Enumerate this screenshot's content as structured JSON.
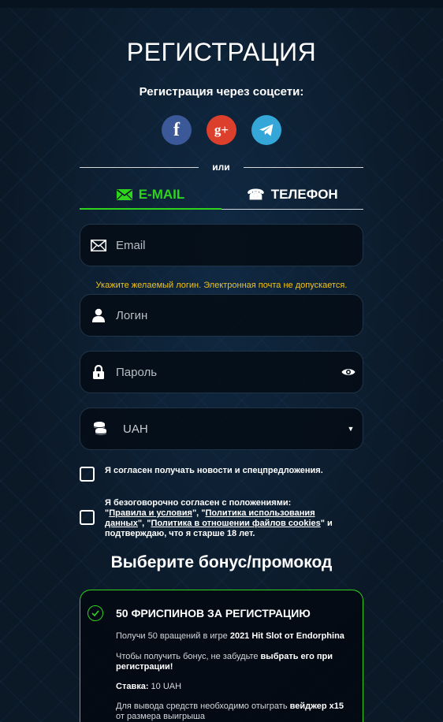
{
  "page": {
    "title": "РЕГИСТРАЦИЯ",
    "social_title": "Регистрация через соцсети:",
    "divider_text": "или"
  },
  "socials": [
    {
      "icon": "facebook-icon",
      "label": "f",
      "color": "#3b5998"
    },
    {
      "icon": "google-plus-icon",
      "label": "g+",
      "color": "#dc3f2c"
    },
    {
      "icon": "telegram-icon",
      "label": "",
      "color": "#34a7d8"
    }
  ],
  "tabs": {
    "email_label": "E-MAIL",
    "phone_label": "ТЕЛЕФОН",
    "active": "email",
    "accent": "#2fd31e"
  },
  "form": {
    "email_placeholder": "Email",
    "login_hint": "Укажите желаемый логин. Электронная почта не допускается.",
    "login_placeholder": "Логин",
    "password_placeholder": "Пароль",
    "currency_value": "UAH"
  },
  "consents": {
    "news_text": "Я согласен получать новости и спецпредложения.",
    "terms_prefix": "Я безоговорочно согласен с положениями: \"",
    "terms_link1": "Правила и условия",
    "terms_mid1": "\", \"",
    "terms_link2": "Политика использования данных",
    "terms_mid2": "\", \"",
    "terms_link3": "Политика в отношении файлов cookies",
    "terms_suffix": "\" и подтверждаю, что я старше 18 лет."
  },
  "bonus": {
    "section_title": "Выберите бонус/промокод",
    "card_title": "50 ФРИСПИНОВ ЗА РЕГИСТРАЦИЮ",
    "line1_prefix": "Получи 50 вращений в игре ",
    "line1_bold": "2021 Hit Slot от Endorphina",
    "line2_prefix": "Чтобы получить бонус, не забудьте ",
    "line2_bold": "выбрать его при регистрации!",
    "stake_label": "Ставка:",
    "stake_value": " 10 UAH",
    "wager_prefix": "Для вывода средств необходимо отыграть ",
    "wager_bold": "вейджер x15",
    "wager_suffix": " от размера выигрыша"
  }
}
